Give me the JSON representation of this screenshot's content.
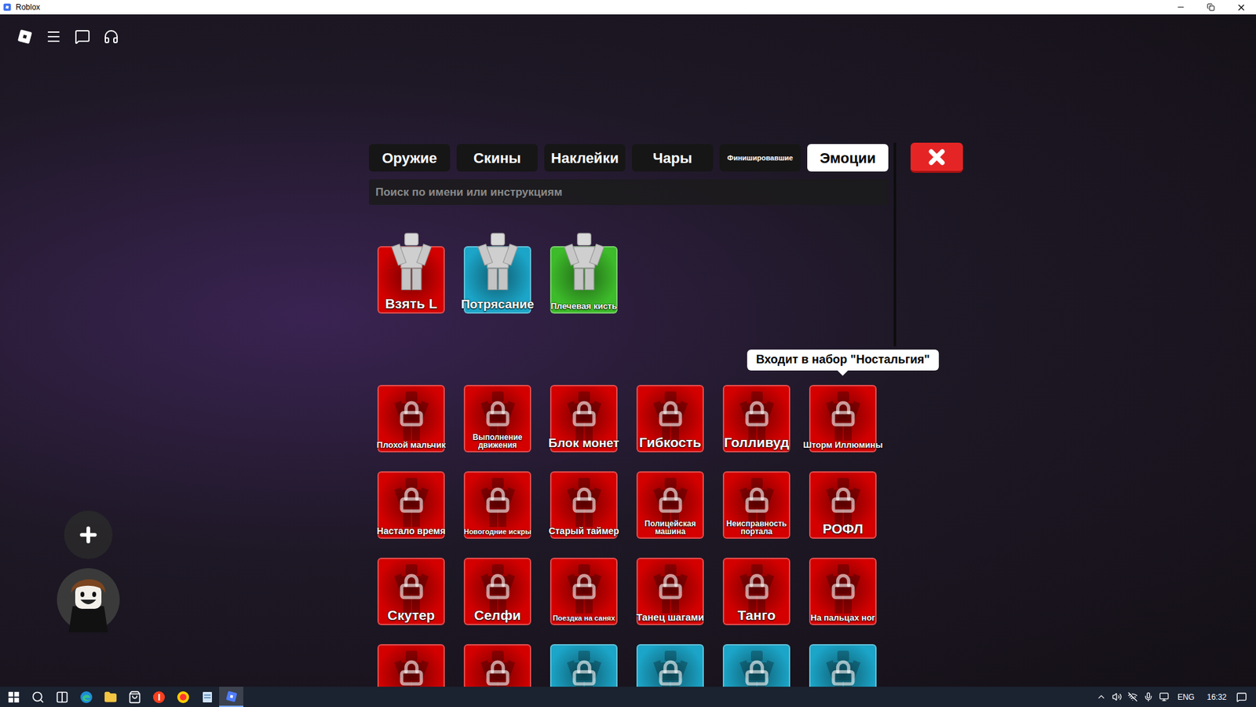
{
  "window": {
    "title": "Roblox"
  },
  "tabs": [
    {
      "label": "Оружие",
      "selected": false
    },
    {
      "label": "Скины",
      "selected": false
    },
    {
      "label": "Наклейки",
      "selected": false
    },
    {
      "label": "Чары",
      "selected": false
    },
    {
      "label": "Финишировавшие",
      "selected": false
    },
    {
      "label": "Эмоции",
      "selected": true
    }
  ],
  "search": {
    "placeholder": "Поиск по имени или инструкциям"
  },
  "equipped": [
    {
      "label": "Взять L",
      "color": "#d40000"
    },
    {
      "label": "Потрясание",
      "color": "#1ba5c8"
    },
    {
      "label": "Плечевая кисть",
      "color": "#3dbb2a"
    }
  ],
  "emotes": [
    {
      "label": "Плохой мальчик",
      "color": "#d40000",
      "locked": true
    },
    {
      "label": "Выполнение движения",
      "color": "#d40000",
      "locked": true
    },
    {
      "label": "Блок монет",
      "color": "#d40000",
      "locked": true
    },
    {
      "label": "Гибкость",
      "color": "#d40000",
      "locked": true
    },
    {
      "label": "Голливуд",
      "color": "#d40000",
      "locked": true
    },
    {
      "label": "Шторм Иллюмины",
      "color": "#d40000",
      "locked": true
    },
    {
      "label": "Настало время",
      "color": "#d40000",
      "locked": true
    },
    {
      "label": "Новогодние искры",
      "color": "#d40000",
      "locked": true
    },
    {
      "label": "Старый таймер",
      "color": "#d40000",
      "locked": true
    },
    {
      "label": "Полицейская машина",
      "color": "#d40000",
      "locked": true
    },
    {
      "label": "Неисправность портала",
      "color": "#d40000",
      "locked": true
    },
    {
      "label": "РОФЛ",
      "color": "#d40000",
      "locked": true
    },
    {
      "label": "Скутер",
      "color": "#d40000",
      "locked": true
    },
    {
      "label": "Селфи",
      "color": "#d40000",
      "locked": true
    },
    {
      "label": "Поездка на санях",
      "color": "#d40000",
      "locked": true
    },
    {
      "label": "Танец шагами",
      "color": "#d40000",
      "locked": true
    },
    {
      "label": "Танго",
      "color": "#d40000",
      "locked": true
    },
    {
      "label": "На пальцах ног",
      "color": "#d40000",
      "locked": true
    },
    {
      "color": "#d40000",
      "locked": true
    },
    {
      "color": "#d40000",
      "locked": true
    },
    {
      "color": "#1ba5c8",
      "locked": true
    },
    {
      "color": "#1ba5c8",
      "locked": true
    },
    {
      "color": "#1ba5c8",
      "locked": true
    },
    {
      "color": "#1ba5c8",
      "locked": true
    }
  ],
  "tooltip": {
    "text": "Входит в набор \"Ностальгия\"",
    "target": "Шторм Иллюмины"
  },
  "taskbar": {
    "apps": [
      {
        "kind": "windows",
        "active": false
      },
      {
        "kind": "search",
        "active": false
      },
      {
        "kind": "taskview",
        "active": false
      },
      {
        "kind": "edge",
        "active": false
      },
      {
        "kind": "explorer",
        "active": false
      },
      {
        "kind": "store",
        "active": false
      },
      {
        "kind": "yandex",
        "active": false
      },
      {
        "kind": "yabrowser",
        "active": false
      },
      {
        "kind": "notes",
        "active": false
      },
      {
        "kind": "roblox",
        "active": true
      }
    ],
    "language": "ENG",
    "time": "16:32"
  }
}
